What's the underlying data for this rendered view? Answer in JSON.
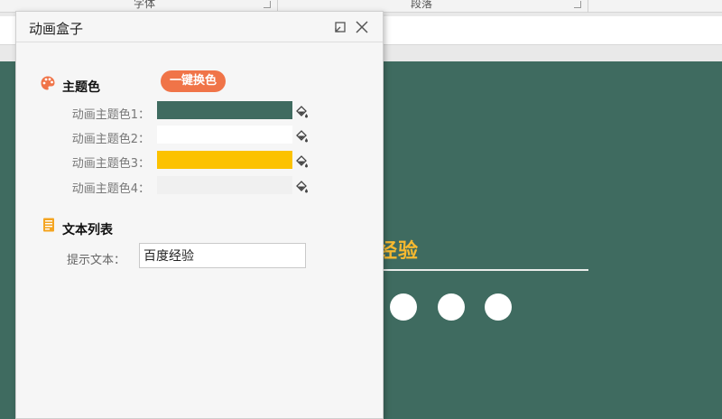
{
  "ribbon": {
    "group1_label": "字体",
    "group2_label": "段落"
  },
  "slide": {
    "title_fragment": "度经验",
    "title_color": "#f7b930",
    "background_color": "#3f6b60",
    "dot_count": 3
  },
  "dialog": {
    "title": "动画盒子",
    "restore_icon": "restore-icon",
    "close_icon": "close-icon",
    "theme_section": {
      "label": "主题色",
      "icon": "palette-icon",
      "quick_button_label": "一键换色",
      "quick_button_color": "#f07448",
      "rows": [
        {
          "label": "动画主题色1：",
          "color": "#3f6b60"
        },
        {
          "label": "动画主题色2：",
          "color": "#ffffff"
        },
        {
          "label": "动画主题色3：",
          "color": "#fcc200"
        },
        {
          "label": "动画主题色4：",
          "color": "#f0f0f0"
        }
      ],
      "bucket_icon": "paint-bucket-icon"
    },
    "text_section": {
      "label": "文本列表",
      "icon": "document-icon",
      "hint_label": "提示文本：",
      "hint_value": "百度经验"
    }
  }
}
